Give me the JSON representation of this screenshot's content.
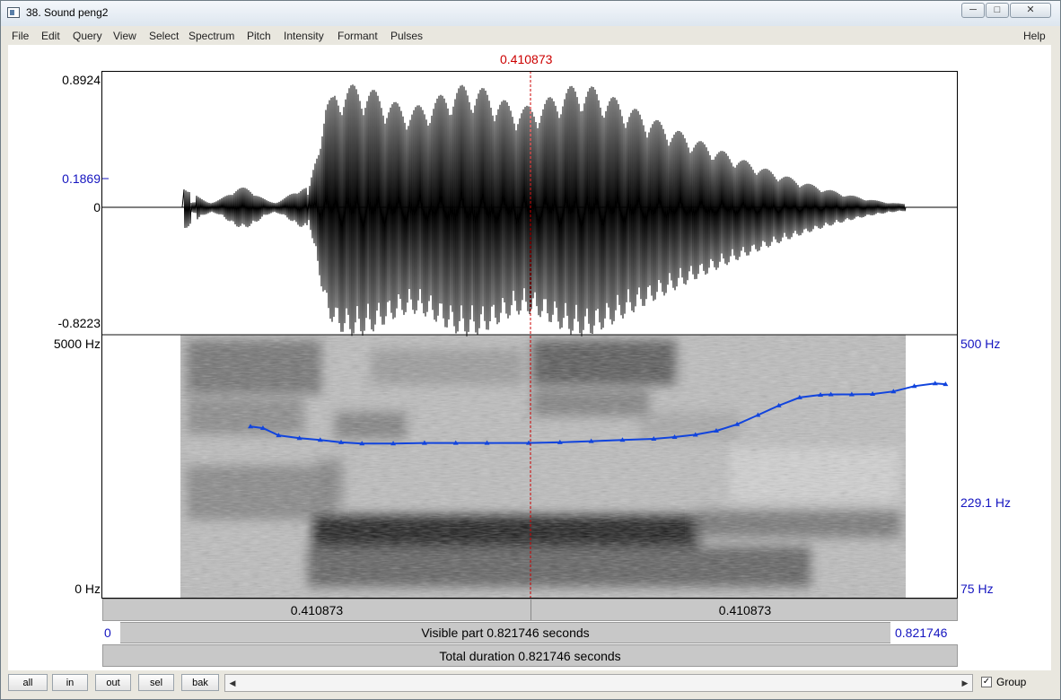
{
  "window": {
    "title": "38. Sound peng2",
    "minimize_icon": "minimize-icon",
    "maximize_icon": "maximize-icon",
    "close_icon": "close-icon"
  },
  "menu": {
    "items": [
      "File",
      "Edit",
      "Query",
      "View",
      "Select",
      "Spectrum",
      "Pitch",
      "Intensity",
      "Formant",
      "Pulses"
    ],
    "help": "Help"
  },
  "cursor": {
    "time_label": "0.410873",
    "time": 0.410873
  },
  "waveform": {
    "max_label": "0.8924",
    "mid_label": "0.1869",
    "zero_label": "0",
    "min_label": "-0.8223",
    "max": 0.8924,
    "min": -0.8223,
    "cursor_amplitude": 0.1869
  },
  "spectrogram": {
    "top_label": "5000 Hz",
    "bottom_label": "0 Hz",
    "freq_max": 5000,
    "freq_min": 0
  },
  "pitch": {
    "top_label": "500 Hz",
    "cursor_label": "229.1 Hz",
    "bottom_label": "75 Hz",
    "max_hz": 500,
    "min_hz": 75,
    "contour_color": "#1144dd",
    "times": [
      0.143,
      0.155,
      0.17,
      0.19,
      0.21,
      0.23,
      0.25,
      0.28,
      0.31,
      0.34,
      0.37,
      0.41,
      0.44,
      0.47,
      0.5,
      0.53,
      0.55,
      0.57,
      0.59,
      0.61,
      0.63,
      0.65,
      0.67,
      0.69,
      0.7,
      0.72,
      0.74,
      0.76,
      0.78,
      0.8,
      0.81
    ],
    "values": [
      258,
      255,
      242,
      237,
      234,
      230,
      228,
      228,
      229,
      229,
      229,
      229,
      230,
      232,
      234,
      236,
      239,
      243,
      250,
      262,
      280,
      300,
      318,
      324,
      325,
      325,
      326,
      332,
      345,
      352,
      350
    ]
  },
  "time_axis": {
    "left_segment_label": "0.410873",
    "right_segment_label": "0.410873",
    "visible_start": "0",
    "visible_end": "0.821746",
    "visible_part": "Visible part 0.821746 seconds",
    "total_duration": "Total duration 0.821746 seconds",
    "duration": 0.821746
  },
  "bottom": {
    "buttons": [
      "all",
      "in",
      "out",
      "sel",
      "bak"
    ],
    "scroll_left_icon": "scroll-left-icon",
    "scroll_right_icon": "scroll-right-icon",
    "group_label": "Group",
    "group_checked": true
  }
}
